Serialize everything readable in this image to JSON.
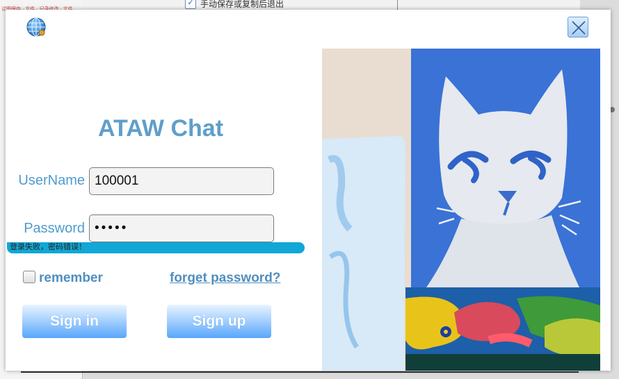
{
  "background": {
    "option_label": "手动保存或复制后退出",
    "left_text": "试图保存 · 文件 · 记录修改 · 文件"
  },
  "dialog": {
    "title": "ATAW Chat",
    "username_label": "UserName",
    "username_value": "100001",
    "password_label": "Password",
    "password_value": "12345",
    "error_message": "登录失败，密码错误！",
    "remember_label": "remember",
    "remember_checked": false,
    "forgot_label": "forget password?",
    "signin_label": "Sign in",
    "signup_label": "Sign up"
  },
  "colors": {
    "accent": "#5f9ecb",
    "error_bar": "#11a7d6",
    "button_bottom": "#58a6fb"
  },
  "icons": {
    "top_left": "globe-icon",
    "top_right": "close-icon"
  }
}
